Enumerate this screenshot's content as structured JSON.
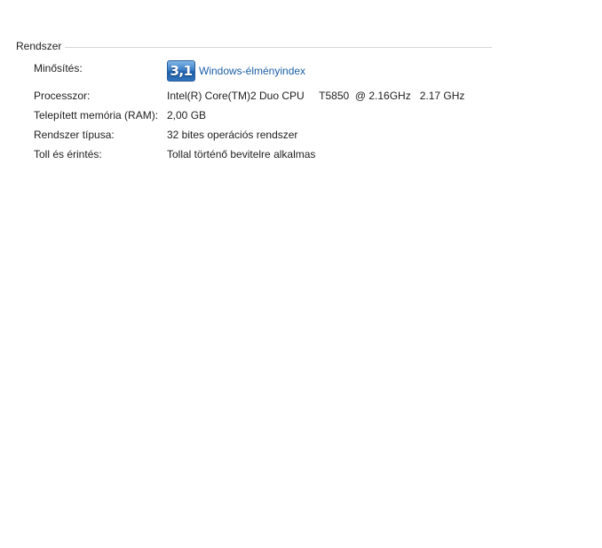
{
  "section": {
    "title": "Rendszer"
  },
  "rating": {
    "label": "Minősítés:",
    "score": "3,1",
    "link_text": "Windows-élményindex"
  },
  "rows": [
    {
      "label": "Processzor:",
      "value": "Intel(R) Core(TM)2 Duo CPU     T5850  @ 2.16GHz   2.17 GHz"
    },
    {
      "label": "Telepített memória (RAM):",
      "value": "2,00 GB"
    },
    {
      "label": "Rendszer típusa:",
      "value": "32 bites operációs rendszer"
    },
    {
      "label": "Toll és érintés:",
      "value": "Tollal történő bevitelre alkalmas"
    }
  ],
  "colors": {
    "link": "#1c5fa8",
    "rule": "#d6d6d6",
    "badge": "#2f74bd"
  }
}
